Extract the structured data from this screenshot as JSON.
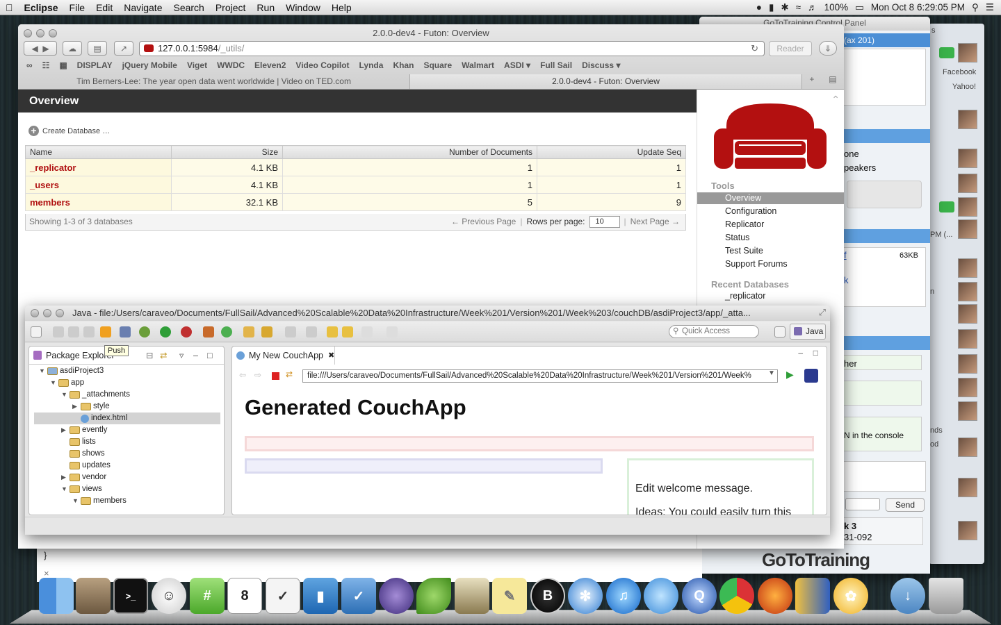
{
  "menubar": {
    "app": "Eclipse",
    "items": [
      "File",
      "Edit",
      "Navigate",
      "Search",
      "Project",
      "Run",
      "Window",
      "Help"
    ],
    "battery": "100%",
    "datetime": "Mon Oct 8  6:29:05 PM"
  },
  "goto": {
    "title": "GoToTraining Control Panel",
    "header": "(ax 201)",
    "line1": "one",
    "line2": "peakers",
    "file_link": "f",
    "file_size": "63KB",
    "link2": "k",
    "other": "her",
    "console": "N in the console",
    "send": "Send",
    "k3": "k 3",
    "code": "31-092",
    "logo": "GoToTraining"
  },
  "rightpanel": {
    "facebook": "Facebook",
    "yahoo": "Yahoo!",
    "s": "s",
    "pm": "PM (...",
    "n": "n",
    "nds": "nds",
    "od": "od"
  },
  "safari": {
    "window_title": "2.0.0-dev4 - Futon: Overview",
    "url_host": "127.0.0.1:5984",
    "url_path": "/_utils/",
    "reader": "Reader",
    "bookmarks": [
      "DISPLAY",
      "jQuery Mobile",
      "Viget",
      "WWDC",
      "Eleven2",
      "Video Copilot",
      "Lynda",
      "Khan",
      "Square",
      "Walmart",
      "ASDI ▾",
      "Full Sail",
      "Discuss ▾"
    ],
    "tabs": [
      "Tim Berners-Lee: The year open data went worldwide | Video on TED.com",
      "2.0.0-dev4 - Futon: Overview"
    ]
  },
  "futon": {
    "heading": "Overview",
    "create": "Create Database …",
    "columns": [
      "Name",
      "Size",
      "Number of Documents",
      "Update Seq"
    ],
    "rows": [
      {
        "name": "_replicator",
        "size": "4.1 KB",
        "docs": "1",
        "seq": "1"
      },
      {
        "name": "_users",
        "size": "4.1 KB",
        "docs": "1",
        "seq": "1"
      },
      {
        "name": "members",
        "size": "32.1 KB",
        "docs": "5",
        "seq": "9"
      }
    ],
    "showing": "Showing 1-3 of 3 databases",
    "prev": "← Previous Page",
    "rows_per_page": "Rows per page:",
    "per_page_value": "10",
    "next": "Next Page →",
    "tools_heading": "Tools",
    "tools": [
      "Overview",
      "Configuration",
      "Replicator",
      "Status",
      "Test Suite",
      "Support Forums"
    ],
    "recent_heading": "Recent Databases",
    "recent": [
      "_replicator"
    ]
  },
  "eclipse": {
    "title": "Java - file:/Users/caraveo/Documents/FullSail/Advanced%20Scalable%20Data%20Infrastructure/Week%201/Version%201/Week%203/couchDB/asdiProject3/app/_atta...",
    "quick_access": "Quick Access",
    "perspective": "Java",
    "tooltip": "Push",
    "explorer_tab": "Package Explorer",
    "tree": [
      {
        "label": "asdiProject3",
        "depth": 0,
        "arrow": "▼",
        "kind": "project"
      },
      {
        "label": "app",
        "depth": 1,
        "arrow": "▼",
        "kind": "folder"
      },
      {
        "label": "_attachments",
        "depth": 2,
        "arrow": "▼",
        "kind": "folder"
      },
      {
        "label": "style",
        "depth": 3,
        "arrow": "▶",
        "kind": "folder"
      },
      {
        "label": "index.html",
        "depth": 3,
        "arrow": "",
        "kind": "file"
      },
      {
        "label": "evently",
        "depth": 2,
        "arrow": "▶",
        "kind": "folder"
      },
      {
        "label": "lists",
        "depth": 2,
        "arrow": "",
        "kind": "folder"
      },
      {
        "label": "shows",
        "depth": 2,
        "arrow": "",
        "kind": "folder"
      },
      {
        "label": "updates",
        "depth": 2,
        "arrow": "",
        "kind": "folder"
      },
      {
        "label": "vendor",
        "depth": 2,
        "arrow": "▶",
        "kind": "folder"
      },
      {
        "label": "views",
        "depth": 2,
        "arrow": "▼",
        "kind": "folder"
      },
      {
        "label": "members",
        "depth": 3,
        "arrow": "▼",
        "kind": "folder"
      }
    ],
    "editor_tab": "My New CouchApp",
    "editor_url": "file:///Users/caraveo/Documents/FullSail/Advanced%20Scalable%20Data%20Infrastructure/Week%201/Version%201/Week%",
    "page_heading": "Generated CouchApp",
    "welcome": "Edit welcome message.",
    "ideas": "Ideas: You could easily turn this"
  },
  "behind": {
    "brace": "}",
    "x": "×"
  },
  "dock": [
    "Finder",
    "Mail",
    "Terminal",
    "Skype",
    "Tweetbot",
    "Calendar",
    "Lists",
    "Get Info",
    "Tasks",
    "Eclipse",
    "Leaf",
    "Tower",
    "Notes",
    "Brackets",
    "Safari",
    "iTunes",
    "Messages",
    "QuickTime",
    "Chrome",
    "Firefox",
    "Charts",
    "Flower",
    "Downloads",
    "Trash"
  ],
  "colors": {
    "futon_red": "#b31010",
    "accent_blue": "#4b8fd6"
  }
}
